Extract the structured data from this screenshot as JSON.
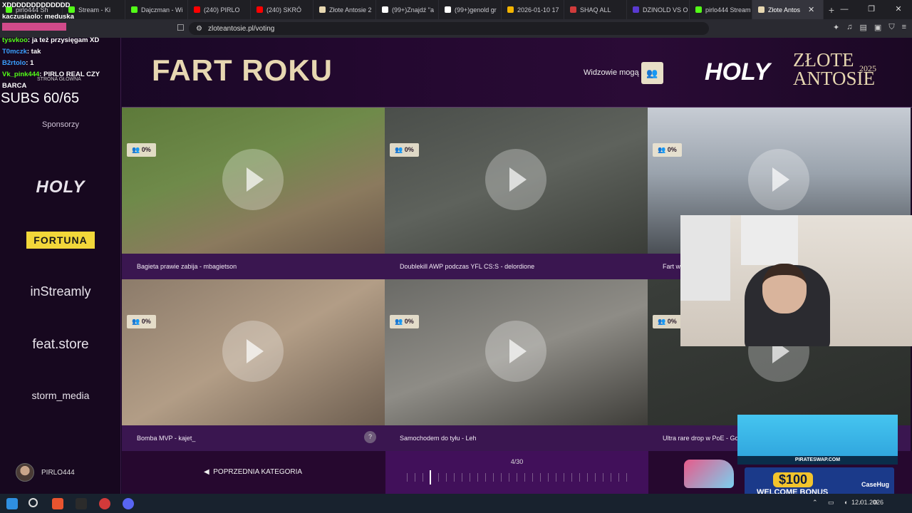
{
  "browser": {
    "tabs": [
      {
        "label": "pirlo444 Sh",
        "color": "#53fc18"
      },
      {
        "label": "Stream - Ki",
        "color": "#53fc18"
      },
      {
        "label": "Dajczman - Wi",
        "color": "#53fc18"
      },
      {
        "label": "(240) PIRLO",
        "color": "#ff0000"
      },
      {
        "label": "(240) SKRÓ",
        "color": "#ff0000"
      },
      {
        "label": "Złote Antosie 2",
        "color": "#e7d7b1"
      },
      {
        "label": "(99+)Znajdź \"a",
        "color": "#ffffff"
      },
      {
        "label": "(99+)genold gr",
        "color": "#ffffff"
      },
      {
        "label": "2026-01-10 17",
        "color": "#f4b400"
      },
      {
        "label": "SHAQ ALL",
        "color": "#d13b3b"
      },
      {
        "label": "DZINOLD VS O",
        "color": "#5a3ad1"
      },
      {
        "label": "pirlo444 Stream",
        "color": "#53fc18"
      },
      {
        "label": "Złote Antos",
        "color": "#e7d7b1",
        "active": true
      }
    ],
    "url": "zloteantosie.pl/voting"
  },
  "chat": [
    {
      "user": "XDDDDDDDDDDDDD",
      "msg": "",
      "color": "#ffffff"
    },
    {
      "user": "kaczusiaolo",
      "msg": "meduska",
      "color": "#ffffff"
    },
    {
      "user": "",
      "msg": "",
      "color": "#d14a8a"
    },
    {
      "user": "tysvkoo",
      "msg": "ja też przysięgam XD",
      "color": "#53fc18"
    },
    {
      "user": "T0mczk",
      "msg": "tak",
      "color": "#3aa0ff"
    },
    {
      "user": "B2rtolo",
      "msg": "1",
      "color": "#3aa0ff"
    },
    {
      "user": "Vk_pink444",
      "msg": "PIRLO REAL CZY",
      "color": "#53fc18"
    },
    {
      "user": "",
      "msg": "BARCA",
      "color": "#ffffff"
    }
  ],
  "subs": "SUBS 60/65",
  "nav_home": "STRONA GŁÓWNA",
  "page": {
    "title": "FART ROKU",
    "viewers_label": "Widzowie mogą",
    "brand_logo": "HOLY",
    "brand_name": "ZŁOTE ANTOSIE",
    "brand_year": "2025"
  },
  "sidebar": {
    "sponsors_title": "Sponsorzy",
    "sponsors": [
      "HOLY",
      "FORTUNA",
      "inStreamly",
      "feat.store",
      "storm_media"
    ],
    "user": "PIRLO444"
  },
  "cards": [
    {
      "caption": "Bagieta prawie zabija - mbagietson",
      "pct": "0%"
    },
    {
      "caption": "Doublekill AWP podczas YFL CS:S - delordione",
      "pct": "0%"
    },
    {
      "caption": "Fart w",
      "pct": "0%"
    },
    {
      "caption": "Bomba MVP - kajet_",
      "pct": "0%"
    },
    {
      "caption": "Samochodem do tyłu - Leh",
      "pct": "0%"
    },
    {
      "caption": "Ultra rare drop w PoE - Go",
      "pct": "0%"
    }
  ],
  "footer": {
    "prev_label": "POPRZEDNIA KATEGORIA",
    "pager": "4/30"
  },
  "ad": {
    "domain": "PIRATESWAP.COM",
    "amount": "$100",
    "bonus": "WELCOME BONUS",
    "brand": "CaseHug"
  },
  "taskbar": {
    "date": "12.01.2026"
  }
}
